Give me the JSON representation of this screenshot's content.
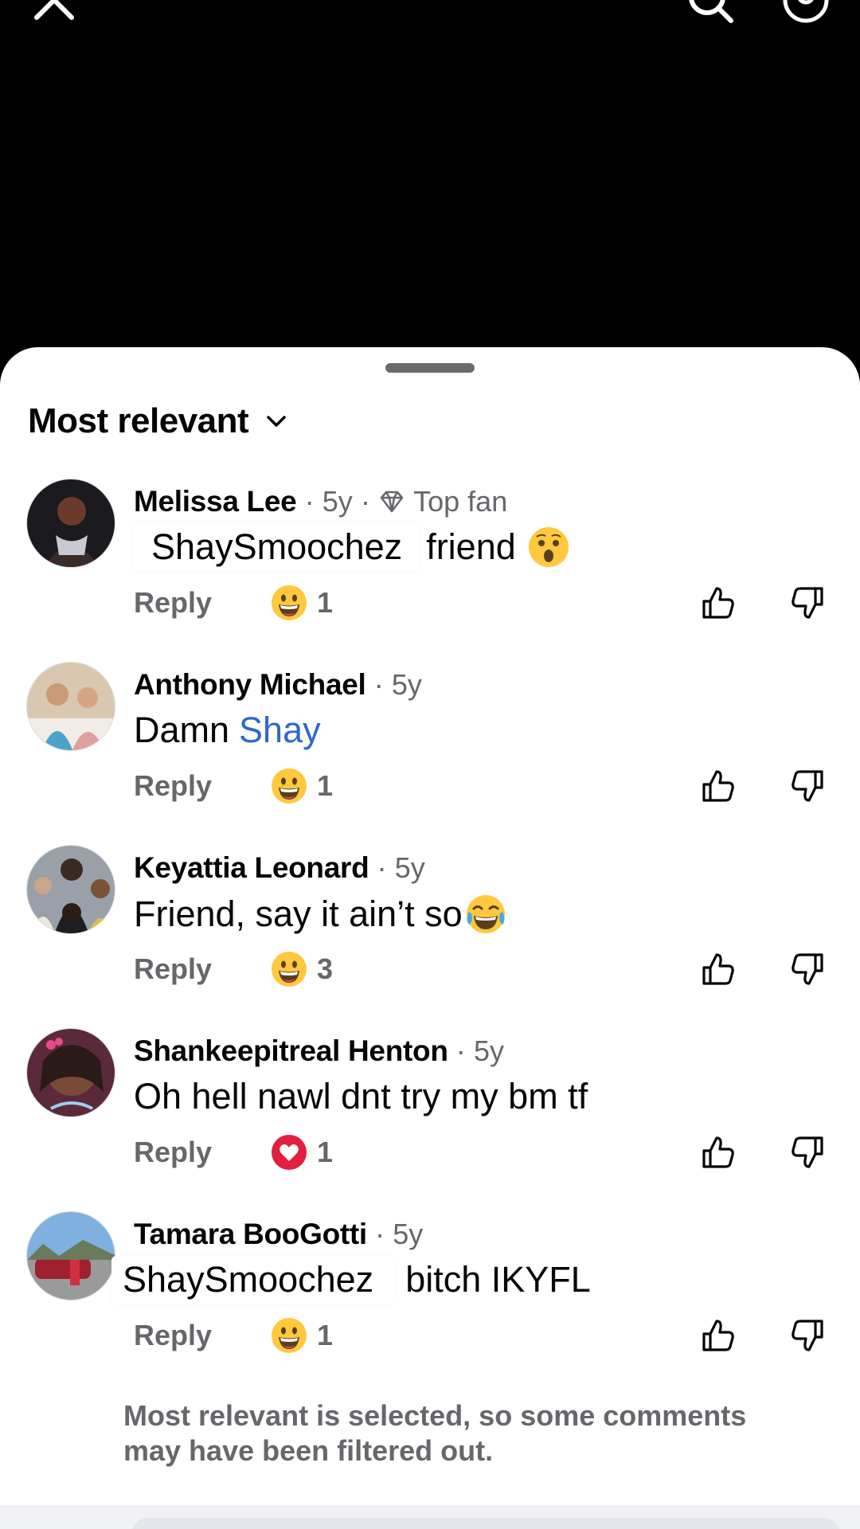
{
  "sort": {
    "label": "Most relevant"
  },
  "comments": [
    {
      "author": "Melissa Lee",
      "time": "5y",
      "badge": "Top fan",
      "overlay_text": "ShaySmoochez",
      "text": "friend",
      "text_emoji": "astonished-face",
      "reply_label": "Reply",
      "reaction_icon": "grinning-face",
      "reaction_count": "1"
    },
    {
      "author": "Anthony Michael",
      "time": "5y",
      "text": "Damn",
      "mention": "Shay",
      "reply_label": "Reply",
      "reaction_icon": "grinning-face",
      "reaction_count": "1"
    },
    {
      "author": "Keyattia Leonard",
      "time": "5y",
      "text": "Friend, say it ain’t so",
      "text_emoji": "tears-of-joy-face",
      "reply_label": "Reply",
      "reaction_icon": "grinning-face",
      "reaction_count": "3"
    },
    {
      "author": "Shankeepitreal Henton",
      "time": "5y",
      "text": "Oh hell nawl dnt try my bm tf",
      "reply_label": "Reply",
      "reaction_icon": "heart",
      "reaction_count": "1"
    },
    {
      "author": "Tamara BooGotti",
      "time": "5y",
      "overlay_text": "ShaySmoochez",
      "text": "bitch IKYFL",
      "reply_label": "Reply",
      "reaction_icon": "grinning-face",
      "reaction_count": "1"
    }
  ],
  "footer": {
    "note": "Most relevant is selected, so some comments may have been filtered out."
  },
  "colors": {
    "mention": "#2f66d0",
    "secondary_text": "#65676b",
    "heart": "#e41e3f"
  }
}
